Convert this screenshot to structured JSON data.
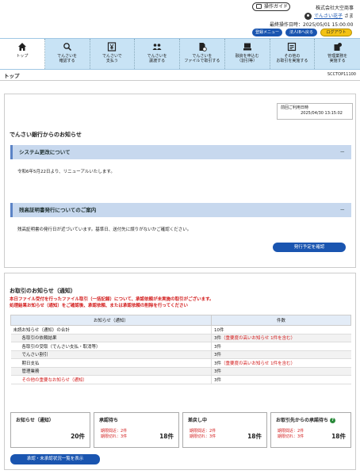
{
  "header": {
    "guide_label": "操作ガイド",
    "company": "株式会社大空商事",
    "user_name": "でんさい花子",
    "user_suffix": " さま",
    "last_login": "最終操作日時：2025/05/01 15:00:00",
    "menu_btn": "登録メニュー",
    "corp_btn": "法人IBへ戻る",
    "logout_btn": "ログアウト"
  },
  "nav": [
    {
      "label": "トップ",
      "icon": "home-icon"
    },
    {
      "label": "でんさいを\n確認する",
      "icon": "search-icon"
    },
    {
      "label": "でんさいで\n支払う",
      "icon": "yen-icon"
    },
    {
      "label": "でんさいを\n譲渡する",
      "icon": "people-icon"
    },
    {
      "label": "でんさいを\nファイルで取引する",
      "icon": "file-icon"
    },
    {
      "label": "融資を申込む\n（割引等）",
      "icon": "loan-icon"
    },
    {
      "label": "その他の\nお取引を実施する",
      "icon": "other-icon"
    },
    {
      "label": "管理業務を\n実施する",
      "icon": "admin-icon"
    }
  ],
  "page": {
    "title": "トップ",
    "code": "SCCTOP11100"
  },
  "announce": {
    "date_label": "前回ご利用日時",
    "date_value": "2025/04/30 13:15:02",
    "section_title": "でんさい銀行からのお知らせ",
    "item1_title": "システム更改について",
    "item1_body": "令和6年5月22日より、リニューアルいたします。",
    "item2_title": "残高証明書発行についてのご案内",
    "item2_body": "残高証明書の発行日が近づいています。基準日、送付先に誤りがないかご確認ください。",
    "button": "発行予定を確認",
    "minus": "－"
  },
  "notices": {
    "title": "お取引のお知らせ（通知）",
    "red_line1": "本日ファイル受付を行ったファイル取引（一括記録）について、承認依頼が未実施の取引がございます。",
    "red_line2": "処理結果お知らせ（通知）をご確認後、承認依頼、または承認依頼の削除を行ってください",
    "col1": "お知らせ（通知）",
    "col2": "件数",
    "rows": [
      {
        "name": "未読お知らせ（通知）の合計",
        "count": "10件",
        "note": ""
      },
      {
        "name": "各取引の依頼結果",
        "count": "3件",
        "note": "（重要度の高いお知らせ 1件を含む）"
      },
      {
        "name": "各取引の受取（でんさい支払・取消等）",
        "count": "3件",
        "note": ""
      },
      {
        "name": "でんさい割引",
        "count": "3件",
        "note": ""
      },
      {
        "name": "期日支払",
        "count": "3件",
        "note": "（重要度の高いお知らせ 1件を含む）"
      },
      {
        "name": "管理業務",
        "count": "3件",
        "note": ""
      },
      {
        "name": "その他の重要なお知らせ（通知）",
        "count": "3件",
        "note": ""
      }
    ],
    "summary": [
      {
        "title": "お知らせ（通知）",
        "total": "20件"
      },
      {
        "title": "承認待ち",
        "line1": "期限間近：2件",
        "line2": "期限切れ：3件",
        "total": "18件"
      },
      {
        "title": "差戻し中",
        "line1": "期限間近：2件",
        "line2": "期限切れ：3件",
        "total": "18件"
      },
      {
        "title": "お取引先からの承諾待ち",
        "line1": "期限間近：2件",
        "line2": "期限切れ：3件",
        "total": "18件"
      }
    ],
    "list_button": "承認・未承認状況一覧を表示"
  }
}
